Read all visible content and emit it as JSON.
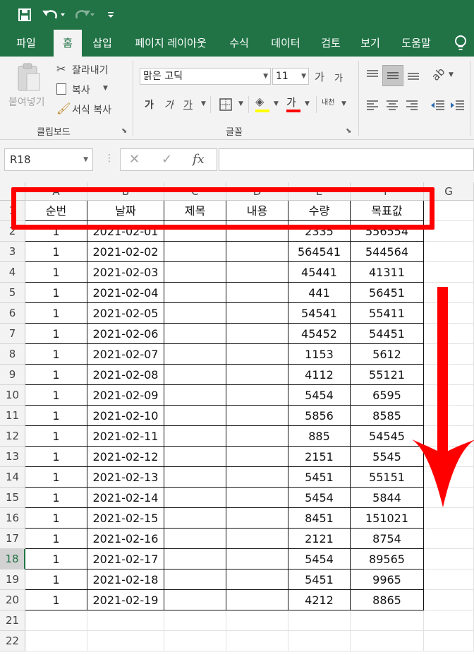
{
  "quick_access": {
    "save_icon": "save-icon",
    "undo_icon": "undo-icon",
    "redo_icon": "redo-icon",
    "customize_icon": "customize-icon"
  },
  "tabs": [
    "파일",
    "홈",
    "삽입",
    "페이지 레이아웃",
    "수식",
    "데이터",
    "검토",
    "보기",
    "도움말"
  ],
  "active_tab": "홈",
  "clipboard": {
    "paste": "붙여넣기",
    "cut": "잘라내기",
    "copy": "복사",
    "format_painter": "서식 복사",
    "group_label": "클립보드"
  },
  "font": {
    "name": "맑은 고딕",
    "size": "11",
    "grow": "가",
    "shrink": "가",
    "bold": "가",
    "italic": "가",
    "underline": "가",
    "font_color_glyph": "가",
    "phonetic": "내천",
    "group_label": "글꼴",
    "fill_color": "#ffff00",
    "font_color": "#ff0000"
  },
  "formula_bar": {
    "name_box": "R18",
    "formula": ""
  },
  "columns": [
    "A",
    "B",
    "C",
    "D",
    "E",
    "F",
    "G"
  ],
  "headers": [
    "순번",
    "날짜",
    "제목",
    "내용",
    "수량",
    "목표값"
  ],
  "rows": [
    [
      "1",
      "2021-02-01",
      "",
      "",
      "2335",
      "556554"
    ],
    [
      "1",
      "2021-02-02",
      "",
      "",
      "564541",
      "544564"
    ],
    [
      "1",
      "2021-02-03",
      "",
      "",
      "45441",
      "41311"
    ],
    [
      "1",
      "2021-02-04",
      "",
      "",
      "441",
      "56451"
    ],
    [
      "1",
      "2021-02-05",
      "",
      "",
      "54541",
      "55411"
    ],
    [
      "1",
      "2021-02-06",
      "",
      "",
      "45452",
      "54451"
    ],
    [
      "1",
      "2021-02-07",
      "",
      "",
      "1153",
      "5612"
    ],
    [
      "1",
      "2021-02-08",
      "",
      "",
      "4112",
      "55121"
    ],
    [
      "1",
      "2021-02-09",
      "",
      "",
      "5454",
      "6595"
    ],
    [
      "1",
      "2021-02-10",
      "",
      "",
      "5856",
      "8585"
    ],
    [
      "1",
      "2021-02-11",
      "",
      "",
      "885",
      "54545"
    ],
    [
      "1",
      "2021-02-12",
      "",
      "",
      "2151",
      "5545"
    ],
    [
      "1",
      "2021-02-13",
      "",
      "",
      "5451",
      "55151"
    ],
    [
      "1",
      "2021-02-14",
      "",
      "",
      "5454",
      "5844"
    ],
    [
      "1",
      "2021-02-15",
      "",
      "",
      "8451",
      "151021"
    ],
    [
      "1",
      "2021-02-16",
      "",
      "",
      "2121",
      "8754"
    ],
    [
      "1",
      "2021-02-17",
      "",
      "",
      "5454",
      "89565"
    ],
    [
      "1",
      "2021-02-18",
      "",
      "",
      "5451",
      "9965"
    ],
    [
      "1",
      "2021-02-19",
      "",
      "",
      "4212",
      "8865"
    ]
  ],
  "row_numbers": [
    "1",
    "2",
    "3",
    "4",
    "5",
    "6",
    "7",
    "8",
    "9",
    "10",
    "11",
    "12",
    "13",
    "14",
    "15",
    "16",
    "17",
    "18",
    "19",
    "20",
    "21",
    "22"
  ],
  "selected_row": "18",
  "annotation_color": "#ff0000"
}
